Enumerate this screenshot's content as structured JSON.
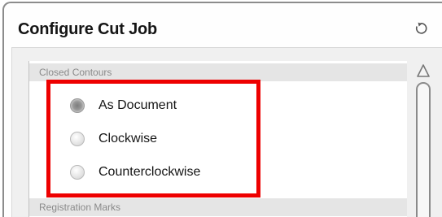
{
  "panel": {
    "title": "Configure Cut Job",
    "reset_icon": "reset-icon"
  },
  "sections": {
    "closed_contours": {
      "header": "Closed Contours",
      "options": [
        {
          "label": "As Document",
          "selected": true
        },
        {
          "label": "Clockwise",
          "selected": false
        },
        {
          "label": "Counterclockwise",
          "selected": false
        }
      ]
    },
    "registration_marks": {
      "header": "Registration Marks"
    }
  },
  "highlight_color": "#ee0000",
  "scrollbar": {
    "up_icon": "scroll-up-arrow-icon"
  }
}
